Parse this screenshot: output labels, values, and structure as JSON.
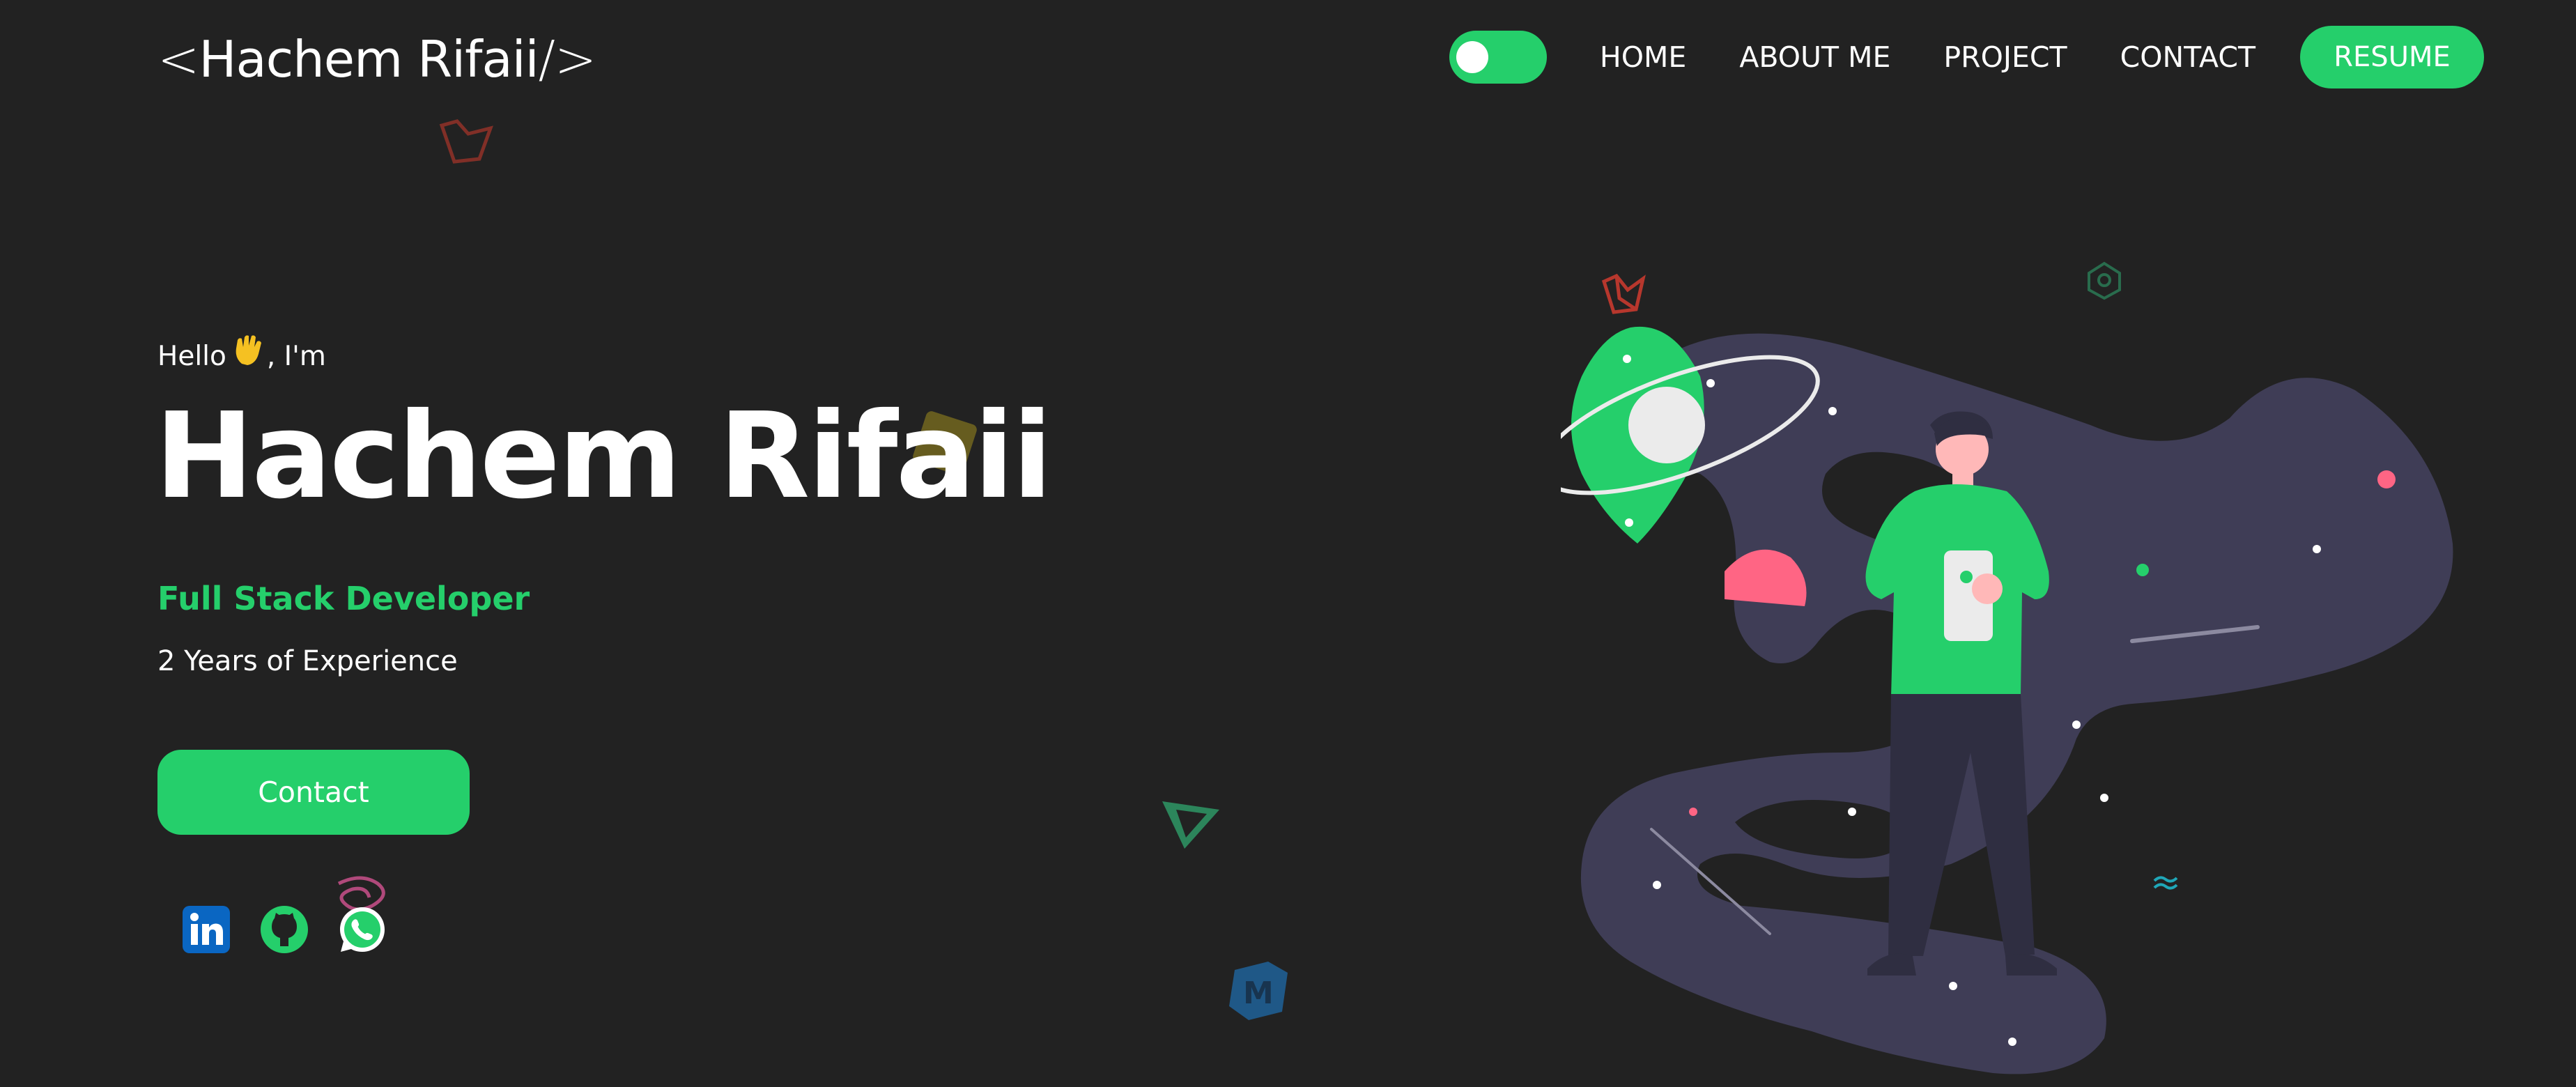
{
  "navbar": {
    "logo_open": "<",
    "logo_name": "Hachem Rifaii",
    "logo_close": "/>",
    "theme_toggle": {
      "state": "on",
      "accent": "#25cf6b"
    },
    "links": [
      {
        "label": "HOME"
      },
      {
        "label": "ABOUT ME"
      },
      {
        "label": "PROJECT"
      },
      {
        "label": "CONTACT"
      }
    ],
    "resume_label": "RESUME"
  },
  "hero": {
    "greeting_before": "Hello",
    "greeting_icon": "waving-hand-icon",
    "greeting_after": ", I'm",
    "name": "Hachem Rifaii",
    "role": "Full Stack Developer",
    "experience": "2 Years of Experience",
    "contact_label": "Contact"
  },
  "social": [
    {
      "icon": "linkedin-icon",
      "color": "#0a66c2"
    },
    {
      "icon": "github-icon",
      "color": "#25cf6b"
    },
    {
      "icon": "whatsapp-icon",
      "color": "#25cf6b"
    }
  ],
  "theme": {
    "background": "#222222",
    "accent": "#25cf6b",
    "text": "#ffffff",
    "illustration_blob": "#3f3d56",
    "illustration_pink": "#ff6584"
  }
}
